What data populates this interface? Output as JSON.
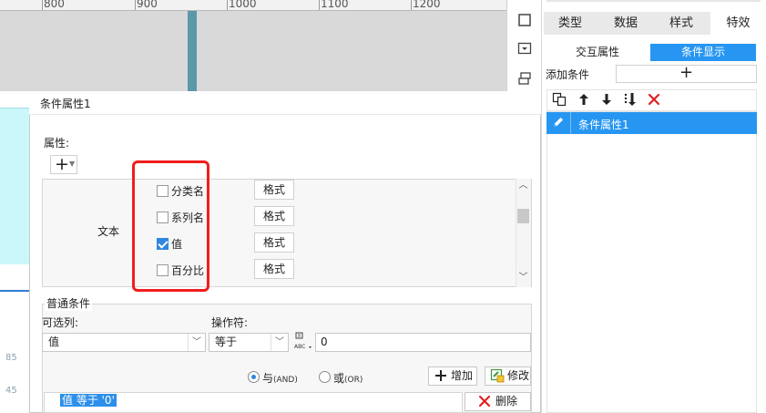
{
  "ruler": {
    "marks": [
      "800",
      "900",
      "1000",
      "1100",
      "1200"
    ]
  },
  "chart_axis": {
    "values": [
      "85",
      "45"
    ]
  },
  "toolbar_icons": [
    "square-icon",
    "dropdown-box-icon",
    "layers-icon"
  ],
  "right_panel": {
    "tabs": [
      "类型",
      "数据",
      "样式",
      "特效"
    ],
    "active_tab": "特效",
    "subtabs": [
      "交互属性",
      "条件显示"
    ],
    "active_subtab": "条件显示",
    "add_condition_label": "添加条件",
    "add_condition_button": "+",
    "condition_toolbar": [
      "copy-icon",
      "move-up-icon",
      "move-down-icon",
      "move-bottom-icon",
      "delete-icon"
    ],
    "condition_items": [
      "条件属性1"
    ]
  },
  "dialog": {
    "title": "条件属性1",
    "attributes_label": "属性:",
    "add_button": "+",
    "attribute_type": "文本",
    "options": [
      {
        "label": "分类名",
        "checked": false,
        "button": "格式"
      },
      {
        "label": "系列名",
        "checked": false,
        "button": "格式"
      },
      {
        "label": "值",
        "checked": true,
        "button": "格式"
      },
      {
        "label": "百分比",
        "checked": false,
        "button": "格式"
      }
    ],
    "normal_condition": {
      "label": "普通条件",
      "column_label": "可选列:",
      "column_value": "值",
      "operator_label": "操作符:",
      "operator_value": "等于",
      "abc_icon_text": "ABC",
      "value": "0",
      "radio_and": "与",
      "radio_and_sub": "(AND)",
      "radio_or": "或",
      "radio_or_sub": "(OR)",
      "selected_radio": "and",
      "add_button": "增加",
      "edit_button": "修改",
      "delete_button": "删除",
      "expression": "值 等于 '0'"
    }
  },
  "colors": {
    "accent": "#2796f2",
    "highlight_box": "#f21d1d",
    "checkbox_on": "#2f86de"
  }
}
